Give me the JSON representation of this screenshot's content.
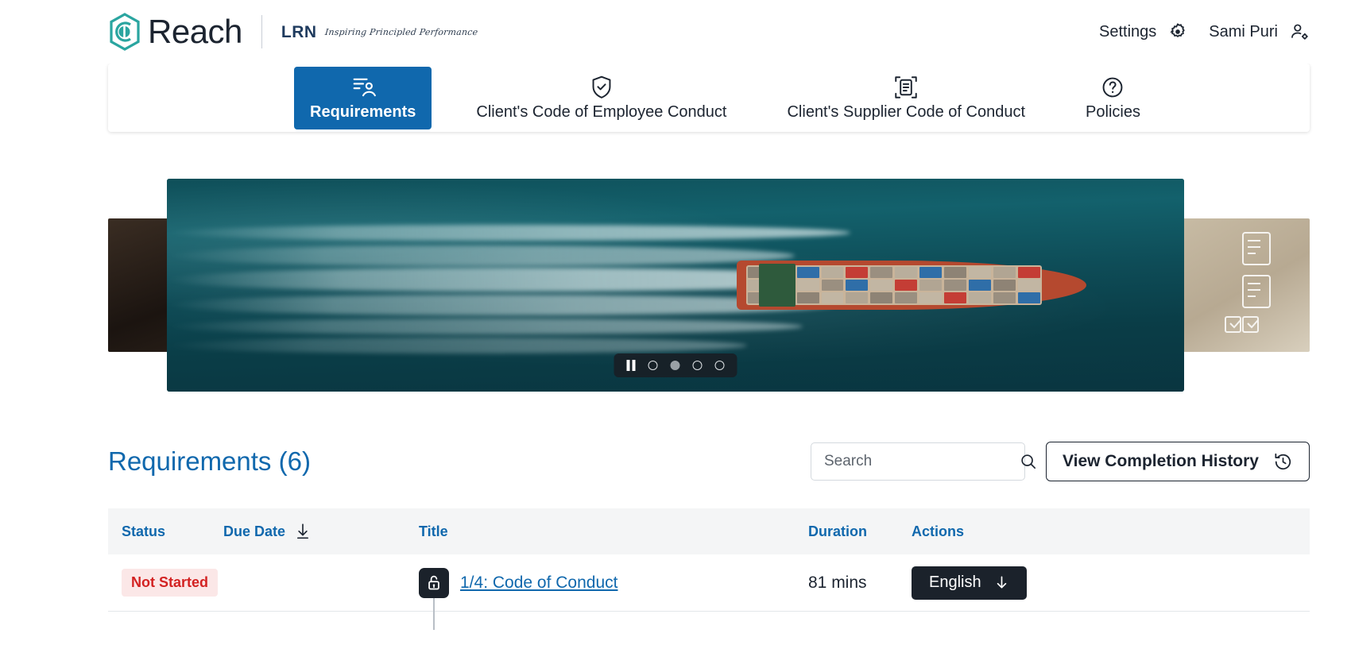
{
  "brand": {
    "name": "Reach",
    "partner_word": "LRN",
    "partner_tagline": "Inspiring Principled Performance"
  },
  "topbar": {
    "settings_label": "Settings",
    "settings_icon": "gear-icon",
    "user_name": "Sami Puri",
    "user_icon": "user-settings-icon"
  },
  "nav": {
    "tabs": [
      {
        "label": "Requirements",
        "icon": "requirements-list-icon",
        "active": true
      },
      {
        "label": "Client's Code of Employee Conduct",
        "icon": "shield-check-icon",
        "active": false
      },
      {
        "label": "Client's Supplier Code of Conduct",
        "icon": "document-scan-icon",
        "active": false
      },
      {
        "label": "Policies",
        "icon": "question-circle-icon",
        "active": false
      }
    ]
  },
  "carousel": {
    "play_state": "playing",
    "pause_icon": "pause-icon",
    "slide_count": 4,
    "active_slide": 2,
    "main_slide_alt": "Aerial view of a container ship at sea"
  },
  "requirements": {
    "heading": "Requirements (6)",
    "search": {
      "placeholder": "Search",
      "value": "",
      "icon": "search-icon"
    },
    "history_button": {
      "label": "View Completion History",
      "icon": "history-clock-icon"
    },
    "columns": [
      "Status",
      "Due Date",
      "Title",
      "Duration",
      "Actions"
    ],
    "sort_column": "Due Date",
    "sort_icon": "sort-down-arrow-icon",
    "rows": [
      {
        "status": "Not Started",
        "status_color": "#d32222",
        "status_bg": "#fbe7e7",
        "due_date": "",
        "lock_icon": "unlock-icon",
        "title": "1/4: Code of Conduct",
        "duration": "81 mins",
        "action_label": "English",
        "action_icon": "download-arrow-icon"
      }
    ]
  }
}
